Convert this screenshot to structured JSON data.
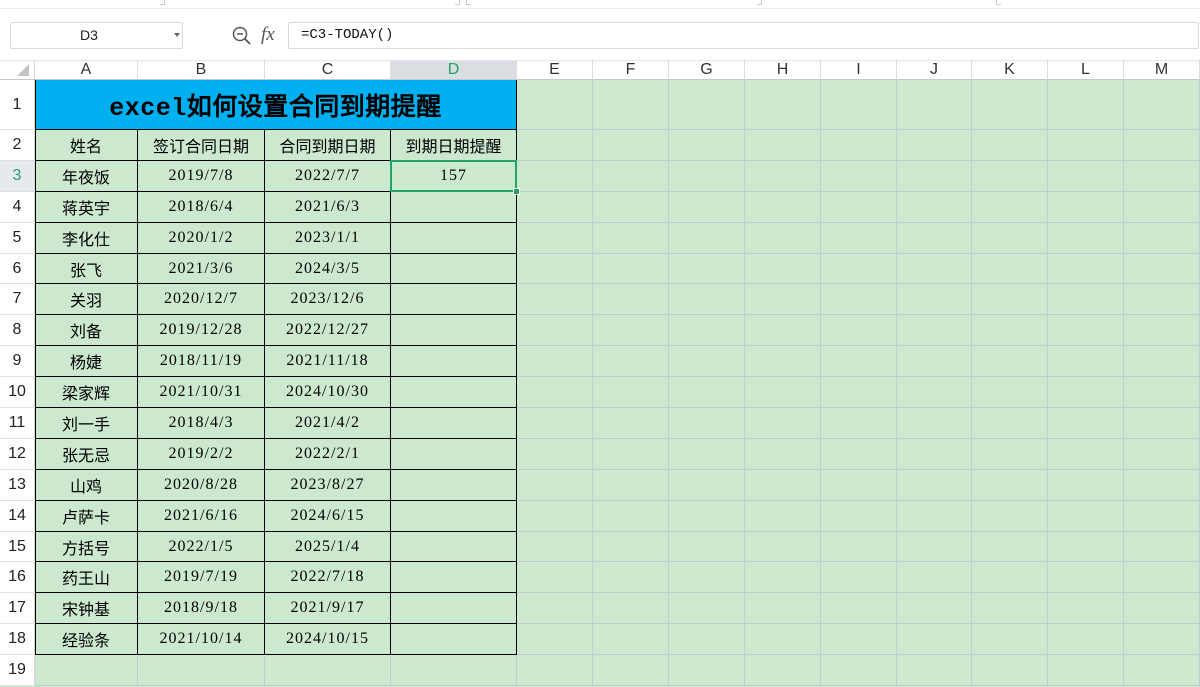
{
  "colors": {
    "sheet_background": "#cce8cf",
    "gridline": "#b9cdd9",
    "title_fill": "#00b0f0",
    "selection_accent": "#21a366",
    "table_border": "#000000"
  },
  "icons": {
    "zoom": "magnifier-icon",
    "name_box_dropdown": "chevron-down-icon",
    "select_all": "select-all-triangle-icon"
  },
  "formula_bar": {
    "name_box": "D3",
    "fx_label": "fx",
    "formula": "=C3-TODAY()"
  },
  "column_headers": [
    "A",
    "B",
    "C",
    "D",
    "E",
    "F",
    "G",
    "H",
    "I",
    "J",
    "K",
    "L",
    "M"
  ],
  "row_headers": [
    "1",
    "2",
    "3",
    "4",
    "5",
    "6",
    "7",
    "8",
    "9",
    "10",
    "11",
    "12",
    "13",
    "14",
    "15",
    "16",
    "17",
    "18",
    "19"
  ],
  "sheet": {
    "title": "excel如何设置合同到期提醒",
    "headers": {
      "name": "姓名",
      "sign_date": "签订合同日期",
      "expire_date": "合同到期日期",
      "reminder": "到期日期提醒"
    },
    "records": [
      {
        "name": "年夜饭",
        "sign_date": "2019/7/8",
        "expire_date": "2022/7/7",
        "reminder": "157"
      },
      {
        "name": "蒋英宇",
        "sign_date": "2018/6/4",
        "expire_date": "2021/6/3",
        "reminder": ""
      },
      {
        "name": "李化仕",
        "sign_date": "2020/1/2",
        "expire_date": "2023/1/1",
        "reminder": ""
      },
      {
        "name": "张飞",
        "sign_date": "2021/3/6",
        "expire_date": "2024/3/5",
        "reminder": ""
      },
      {
        "name": "关羽",
        "sign_date": "2020/12/7",
        "expire_date": "2023/12/6",
        "reminder": ""
      },
      {
        "name": "刘备",
        "sign_date": "2019/12/28",
        "expire_date": "2022/12/27",
        "reminder": ""
      },
      {
        "name": "杨婕",
        "sign_date": "2018/11/19",
        "expire_date": "2021/11/18",
        "reminder": ""
      },
      {
        "name": "梁家辉",
        "sign_date": "2021/10/31",
        "expire_date": "2024/10/30",
        "reminder": ""
      },
      {
        "name": "刘一手",
        "sign_date": "2018/4/3",
        "expire_date": "2021/4/2",
        "reminder": ""
      },
      {
        "name": "张无忌",
        "sign_date": "2019/2/2",
        "expire_date": "2022/2/1",
        "reminder": ""
      },
      {
        "name": "山鸡",
        "sign_date": "2020/8/28",
        "expire_date": "2023/8/27",
        "reminder": ""
      },
      {
        "name": "卢萨卡",
        "sign_date": "2021/6/16",
        "expire_date": "2024/6/15",
        "reminder": ""
      },
      {
        "name": "方括号",
        "sign_date": "2022/1/5",
        "expire_date": "2025/1/4",
        "reminder": ""
      },
      {
        "name": "药王山",
        "sign_date": "2019/7/19",
        "expire_date": "2022/7/18",
        "reminder": ""
      },
      {
        "name": "宋钟基",
        "sign_date": "2018/9/18",
        "expire_date": "2021/9/17",
        "reminder": ""
      },
      {
        "name": "经验条",
        "sign_date": "2021/10/14",
        "expire_date": "2024/10/15",
        "reminder": ""
      }
    ]
  }
}
